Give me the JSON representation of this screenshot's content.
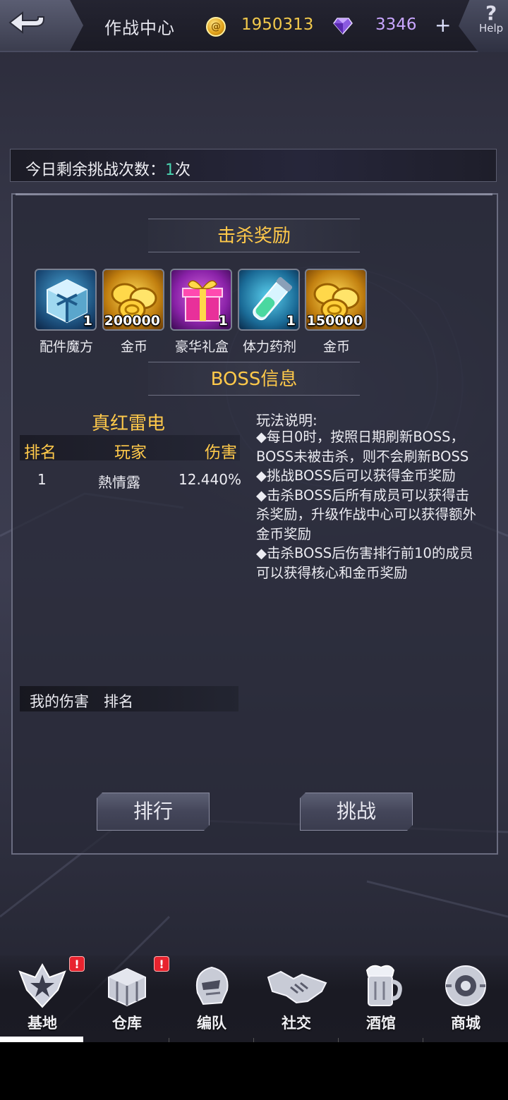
{
  "header": {
    "title": "作战中心",
    "gold": "1950313",
    "gems": "3346",
    "plus": "+",
    "help_mark": "?",
    "help_label": "Help"
  },
  "challenge": {
    "label": "今日剩余挑战次数：",
    "count": "1",
    "unit": "次"
  },
  "kill_reward": {
    "title": "击杀奖励",
    "items": [
      {
        "name": "配件魔方",
        "qty": "1",
        "icon": "parts-cube-icon"
      },
      {
        "name": "金币",
        "qty": "200000",
        "icon": "gold-coins-icon"
      },
      {
        "name": "豪华礼盒",
        "qty": "1",
        "icon": "deluxe-gift-box-icon"
      },
      {
        "name": "体力药剂",
        "qty": "1",
        "icon": "stamina-potion-icon"
      },
      {
        "name": "金币",
        "qty": "150000",
        "icon": "gold-coins-icon"
      }
    ]
  },
  "boss_info": {
    "title": "BOSS信息",
    "boss_name": "真红雷电",
    "columns": [
      "排名",
      "玩家",
      "伤害"
    ],
    "rows": [
      {
        "rank": "1",
        "player": "熱情露",
        "damage": "12.440%"
      }
    ],
    "rules_title": "玩法说明:",
    "rules": [
      "◆每日0时，按照日期刷新BOSS，BOSS未被击杀，则不会刷新BOSS",
      "◆挑战BOSS后可以获得金币奖励",
      "◆击杀BOSS后所有成员可以获得击杀奖励，升级作战中心可以获得额外金币奖励",
      "◆击杀BOSS后伤害排行前10的成员可以获得核心和金币奖励"
    ],
    "my_damage_label": "我的伤害",
    "my_rank_label": "排名"
  },
  "actions": {
    "ranking": "排行",
    "challenge": "挑战"
  },
  "nav": {
    "items": [
      {
        "label": "基地",
        "icon": "base-emblem-icon",
        "badge": "!"
      },
      {
        "label": "仓库",
        "icon": "warehouse-crate-icon",
        "badge": "!"
      },
      {
        "label": "编队",
        "icon": "formation-helmet-icon"
      },
      {
        "label": "社交",
        "icon": "handshake-icon"
      },
      {
        "label": "酒馆",
        "icon": "tavern-mug-icon"
      },
      {
        "label": "商城",
        "icon": "shop-orb-icon"
      }
    ]
  },
  "colors": {
    "accent_gold": "#ffc94a",
    "count_teal": "#49d3b0",
    "gem_purple": "#c9a6ff",
    "badge_red": "#e8232e"
  }
}
